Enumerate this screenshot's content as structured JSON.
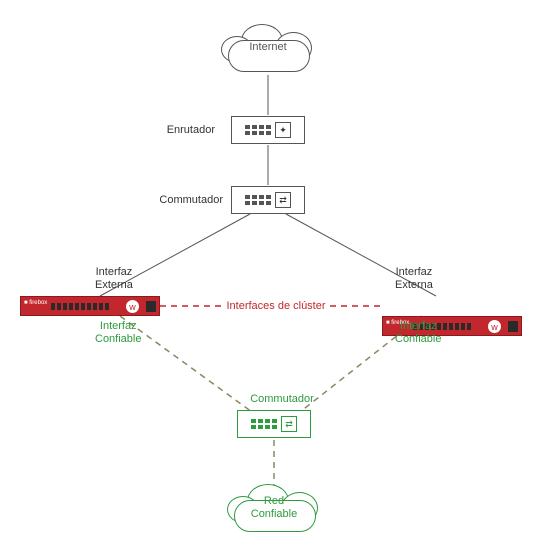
{
  "labels": {
    "internet": "Internet",
    "router": "Enrutador",
    "switch_top": "Commutador",
    "ext_if_left": "Interfaz\nExterna",
    "ext_if_right": "Interfaz\nExterna",
    "cluster_if": "Interfaces de clúster",
    "trust_if_left": "Interfaz\nConfiable",
    "trust_if_right": "Interfaz\nConfiable",
    "switch_bottom": "Commutador",
    "trusted_net": "Red\nConfiable"
  },
  "colors": {
    "firewall": "#c1272d",
    "trusted": "#2e9b3f",
    "line": "#555555"
  },
  "diagram": {
    "type": "network-topology",
    "nodes": [
      {
        "id": "internet",
        "kind": "cloud",
        "label_key": "internet"
      },
      {
        "id": "router",
        "kind": "router",
        "label_key": "router"
      },
      {
        "id": "switch_top",
        "kind": "switch",
        "label_key": "switch_top"
      },
      {
        "id": "fw_left",
        "kind": "firewall"
      },
      {
        "id": "fw_right",
        "kind": "firewall"
      },
      {
        "id": "switch_bottom",
        "kind": "switch",
        "label_key": "switch_bottom",
        "style": "trusted"
      },
      {
        "id": "trusted_net",
        "kind": "cloud",
        "label_key": "trusted_net",
        "style": "trusted"
      }
    ],
    "edges": [
      {
        "from": "internet",
        "to": "router",
        "style": "solid"
      },
      {
        "from": "router",
        "to": "switch_top",
        "style": "solid"
      },
      {
        "from": "switch_top",
        "to": "fw_left",
        "style": "solid",
        "label_key": "ext_if_left"
      },
      {
        "from": "switch_top",
        "to": "fw_right",
        "style": "solid",
        "label_key": "ext_if_right"
      },
      {
        "from": "fw_left",
        "to": "fw_right",
        "style": "dashed",
        "label_key": "cluster_if",
        "color": "firewall"
      },
      {
        "from": "fw_left",
        "to": "switch_bottom",
        "style": "dashed",
        "label_key": "trust_if_left",
        "color": "trusted"
      },
      {
        "from": "fw_right",
        "to": "switch_bottom",
        "style": "dashed",
        "label_key": "trust_if_right",
        "color": "trusted"
      },
      {
        "from": "switch_bottom",
        "to": "trusted_net",
        "style": "dashed",
        "color": "trusted"
      }
    ]
  }
}
